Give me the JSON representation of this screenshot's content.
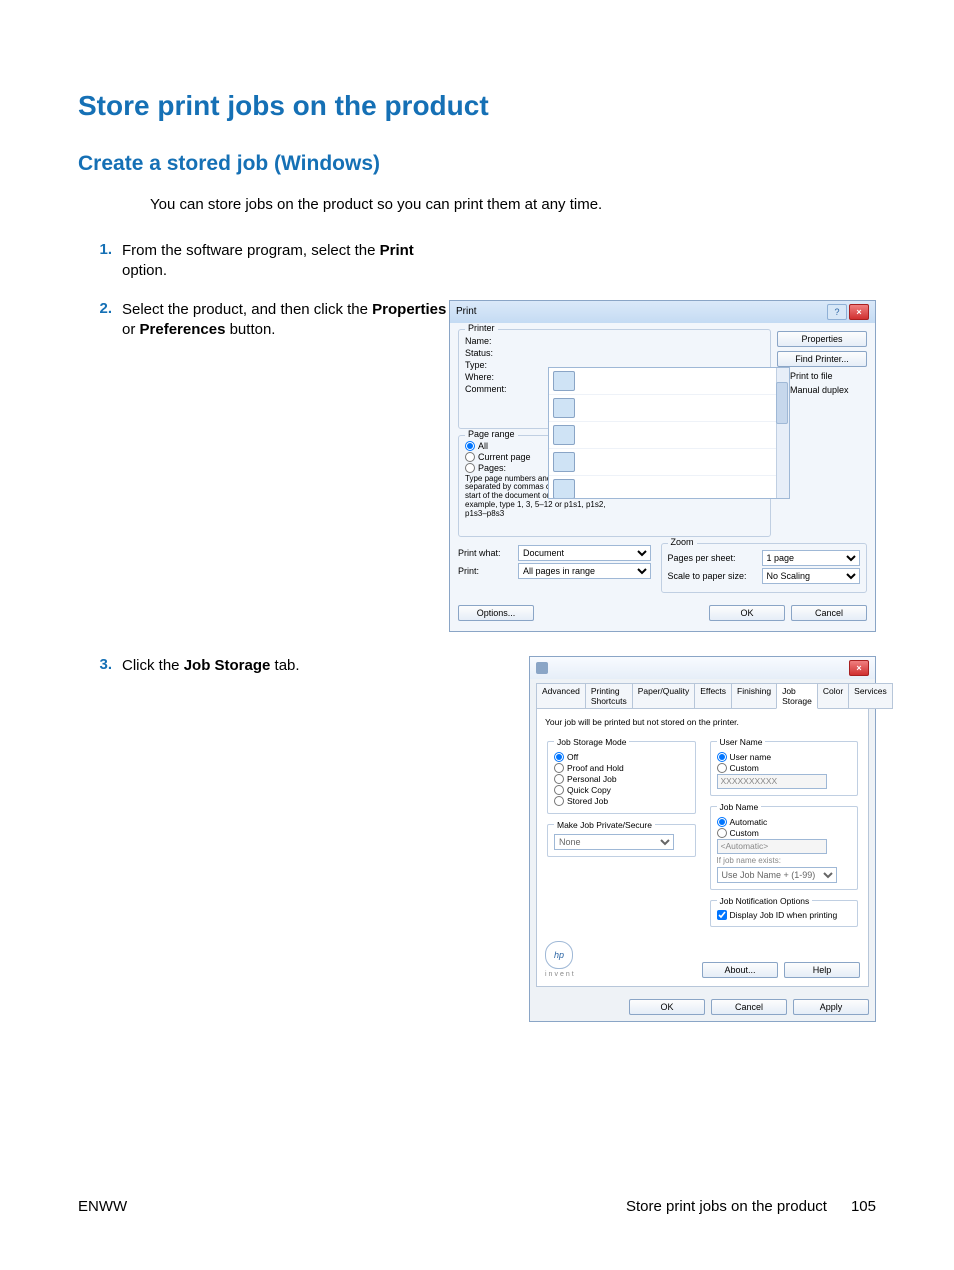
{
  "headings": {
    "h1": "Store print jobs on the product",
    "h2": "Create a stored job (Windows)"
  },
  "intro": "You can store jobs on the product so you can print them at any time.",
  "steps": {
    "s1": {
      "num": "1.",
      "a": "From the software program, select the ",
      "b": "Print",
      "c": " option."
    },
    "s2": {
      "num": "2.",
      "a": "Select the product, and then click the ",
      "b": "Properties",
      "c": " or ",
      "d": "Preferences",
      "e": " button."
    },
    "s3": {
      "num": "3.",
      "a": "Click the ",
      "b": "Job Storage",
      "c": " tab."
    }
  },
  "footer": {
    "left": "ENWW",
    "rightText": "Store print jobs on the product",
    "pageNum": "105"
  },
  "dlg1": {
    "title": "Print",
    "close": "×",
    "help": "?",
    "printerGroup": "Printer",
    "name": "Name:",
    "status": "Status:",
    "type": "Type:",
    "where": "Where:",
    "comment": "Comment:",
    "properties": "Properties",
    "findPrinter": "Find Printer...",
    "printToFile": "Print to file",
    "manualDuplex": "Manual duplex",
    "pageRange": "Page range",
    "all": "All",
    "current": "Current page",
    "pages": "Pages:",
    "rangeHint1": "Type page numbers and/or page ranges separated by commas counting from the start of the document or the section. For example, type 1, 3, 5–12 or p1s1, p1s2, p1s3–p8s3",
    "printWhat": "Print what:",
    "printWhatVal": "Document",
    "print": "Print:",
    "printVal": "All pages in range",
    "zoom": "Zoom",
    "pagesPerSheet": "Pages per sheet:",
    "pagesPerSheetVal": "1 page",
    "scaleToPaper": "Scale to paper size:",
    "scaleToPaperVal": "No Scaling",
    "options": "Options...",
    "ok": "OK",
    "cancel": "Cancel"
  },
  "dlg2": {
    "close": "×",
    "tabs": {
      "advanced": "Advanced",
      "shortcuts": "Printing Shortcuts",
      "paper": "Paper/Quality",
      "effects": "Effects",
      "finishing": "Finishing",
      "jobStorage": "Job Storage",
      "color": "Color",
      "services": "Services"
    },
    "desc": "Your job will be printed but not stored on the printer.",
    "modeGroup": "Job Storage Mode",
    "mode": {
      "off": "Off",
      "proof": "Proof and Hold",
      "personal": "Personal Job",
      "quick": "Quick Copy",
      "stored": "Stored Job"
    },
    "secureGroup": "Make Job Private/Secure",
    "secureVal": "None",
    "userGroup": "User Name",
    "userName": "User name",
    "custom": "Custom",
    "userVal": "XXXXXXXXXX",
    "jobNameGroup": "Job Name",
    "automatic": "Automatic",
    "jobNameVal": "<Automatic>",
    "exists": "If job name exists:",
    "existsVal": "Use Job Name + (1-99)",
    "notifGroup": "Job Notification Options",
    "displayId": "Display Job ID when printing",
    "hpText": "hp",
    "invent": "invent",
    "about": "About...",
    "help": "Help",
    "ok": "OK",
    "cancel": "Cancel",
    "apply": "Apply"
  }
}
